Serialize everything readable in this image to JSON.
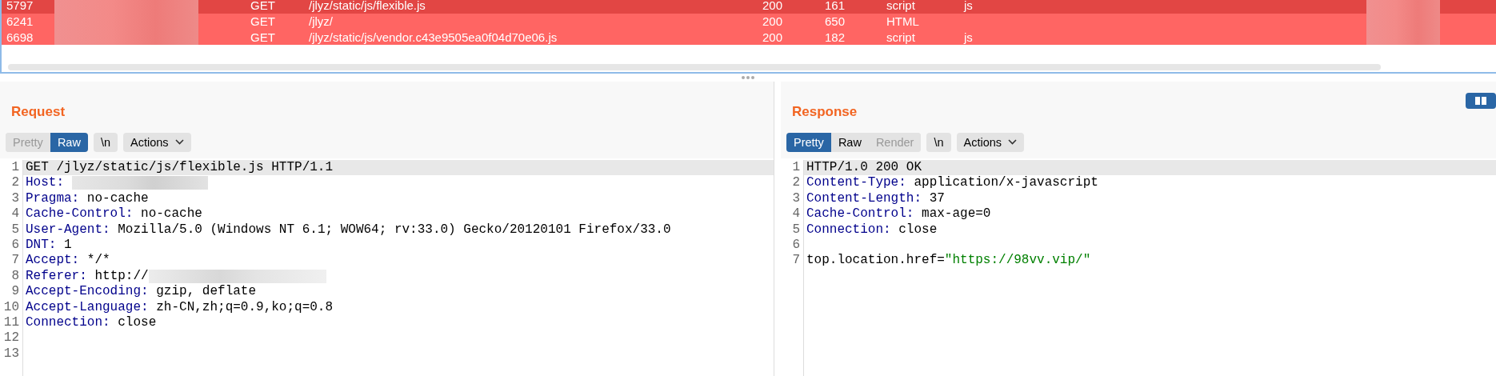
{
  "proxy_history": {
    "rows": [
      {
        "id": "5797",
        "method": "GET",
        "url": "/jlyz/static/js/flexible.js",
        "status": "200",
        "length": "161",
        "mime": "script",
        "extension": "js",
        "selected": true
      },
      {
        "id": "6241",
        "method": "GET",
        "url": "/jlyz/",
        "status": "200",
        "length": "650",
        "mime": "HTML",
        "selected": false
      },
      {
        "id": "6698",
        "method": "GET",
        "url": "/jlyz/static/js/vendor.c43e9505ea0f04d70e06.js",
        "status": "200",
        "length": "182",
        "mime": "script",
        "extension": "js",
        "selected": false
      }
    ]
  },
  "request": {
    "title": "Request",
    "view_modes": [
      {
        "label": "Pretty",
        "selected": false,
        "disabled": true
      },
      {
        "label": "Raw",
        "selected": true,
        "disabled": false
      }
    ],
    "newline_toggle": "\\n",
    "actions": "Actions",
    "lines": [
      {
        "number": "1",
        "kind": "plain",
        "text": "GET /jlyz/static/js/flexible.js HTTP/1.1",
        "current": true
      },
      {
        "number": "2",
        "kind": "header",
        "key": "Host:",
        "redacted": true,
        "current": false
      },
      {
        "number": "3",
        "kind": "header",
        "key": "Pragma:",
        "value": "no-cache",
        "current": false
      },
      {
        "number": "4",
        "kind": "header",
        "key": "Cache-Control:",
        "value": "no-cache",
        "current": false
      },
      {
        "number": "5",
        "kind": "header",
        "key": "User-Agent:",
        "value": "Mozilla/5.0 (Windows NT 6.1; WOW64; rv:33.0) Gecko/20120101 Firefox/33.0",
        "current": false
      },
      {
        "number": "6",
        "kind": "header",
        "key": "DNT:",
        "value": "1",
        "current": false
      },
      {
        "number": "7",
        "kind": "header",
        "key": "Accept:",
        "value": "*/*",
        "current": false
      },
      {
        "number": "8",
        "kind": "header",
        "key": "Referer:",
        "value": "http://",
        "redacted": true,
        "current": false
      },
      {
        "number": "9",
        "kind": "header",
        "key": "Accept-Encoding:",
        "value": "gzip, deflate",
        "current": false
      },
      {
        "number": "10",
        "kind": "header",
        "key": "Accept-Language:",
        "value": "zh-CN,zh;q=0.9,ko;q=0.8",
        "current": false
      },
      {
        "number": "11",
        "kind": "header",
        "key": "Connection:",
        "value": "close",
        "current": false
      },
      {
        "number": "12",
        "kind": "blank",
        "current": false
      },
      {
        "number": "13",
        "kind": "blank",
        "current": false
      }
    ]
  },
  "response": {
    "title": "Response",
    "view_modes": [
      {
        "label": "Pretty",
        "selected": true,
        "disabled": false
      },
      {
        "label": "Raw",
        "selected": false,
        "disabled": false
      },
      {
        "label": "Render",
        "selected": false,
        "disabled": true
      }
    ],
    "newline_toggle": "\\n",
    "actions": "Actions",
    "lines": [
      {
        "number": "1",
        "kind": "plain",
        "text": "HTTP/1.0 200 OK",
        "current": true
      },
      {
        "number": "2",
        "kind": "header",
        "key": "Content-Type:",
        "value": "application/x-javascript",
        "current": false
      },
      {
        "number": "3",
        "kind": "header",
        "key": "Content-Length:",
        "value": "37",
        "current": false
      },
      {
        "number": "4",
        "kind": "header",
        "key": "Cache-Control:",
        "value": "max-age=0",
        "current": false
      },
      {
        "number": "5",
        "kind": "header",
        "key": "Connection:",
        "value": "close",
        "current": false
      },
      {
        "number": "6",
        "kind": "blank",
        "current": false
      },
      {
        "number": "7",
        "kind": "script",
        "code": "top.location.href=",
        "string": "\"https://98vv.vip/\"",
        "current": false
      }
    ]
  }
}
